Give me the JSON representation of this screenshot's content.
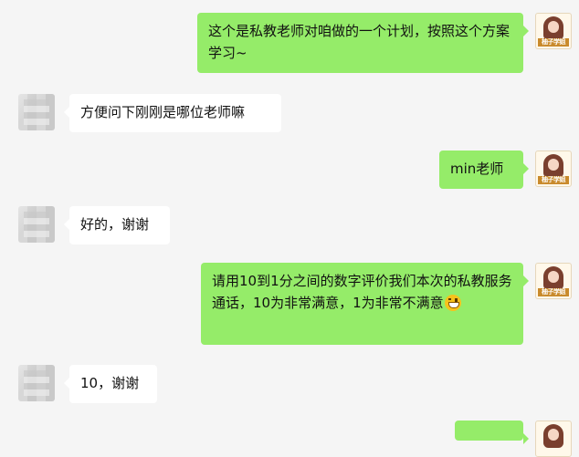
{
  "chat": {
    "messages": [
      {
        "side": "right",
        "text": "这个是私教老师对咱做的一个计划，按照这个方案学习~"
      },
      {
        "side": "left",
        "text": "方便问下刚刚是哪位老师嘛"
      },
      {
        "side": "right",
        "text": "min老师"
      },
      {
        "side": "left",
        "text": "好的，谢谢"
      },
      {
        "side": "right",
        "text": "请用10到1分之间的数字评价我们本次的私教服务通话，10为非常满意，1为非常不满意",
        "emoji": "grinning-face-emoji"
      },
      {
        "side": "left",
        "text": "10，谢谢"
      }
    ]
  },
  "avatar": {
    "brand_text": "柚子学姐"
  },
  "colors": {
    "background": "#f5f5f5",
    "right_bubble": "#95ec69",
    "left_bubble": "#ffffff"
  }
}
